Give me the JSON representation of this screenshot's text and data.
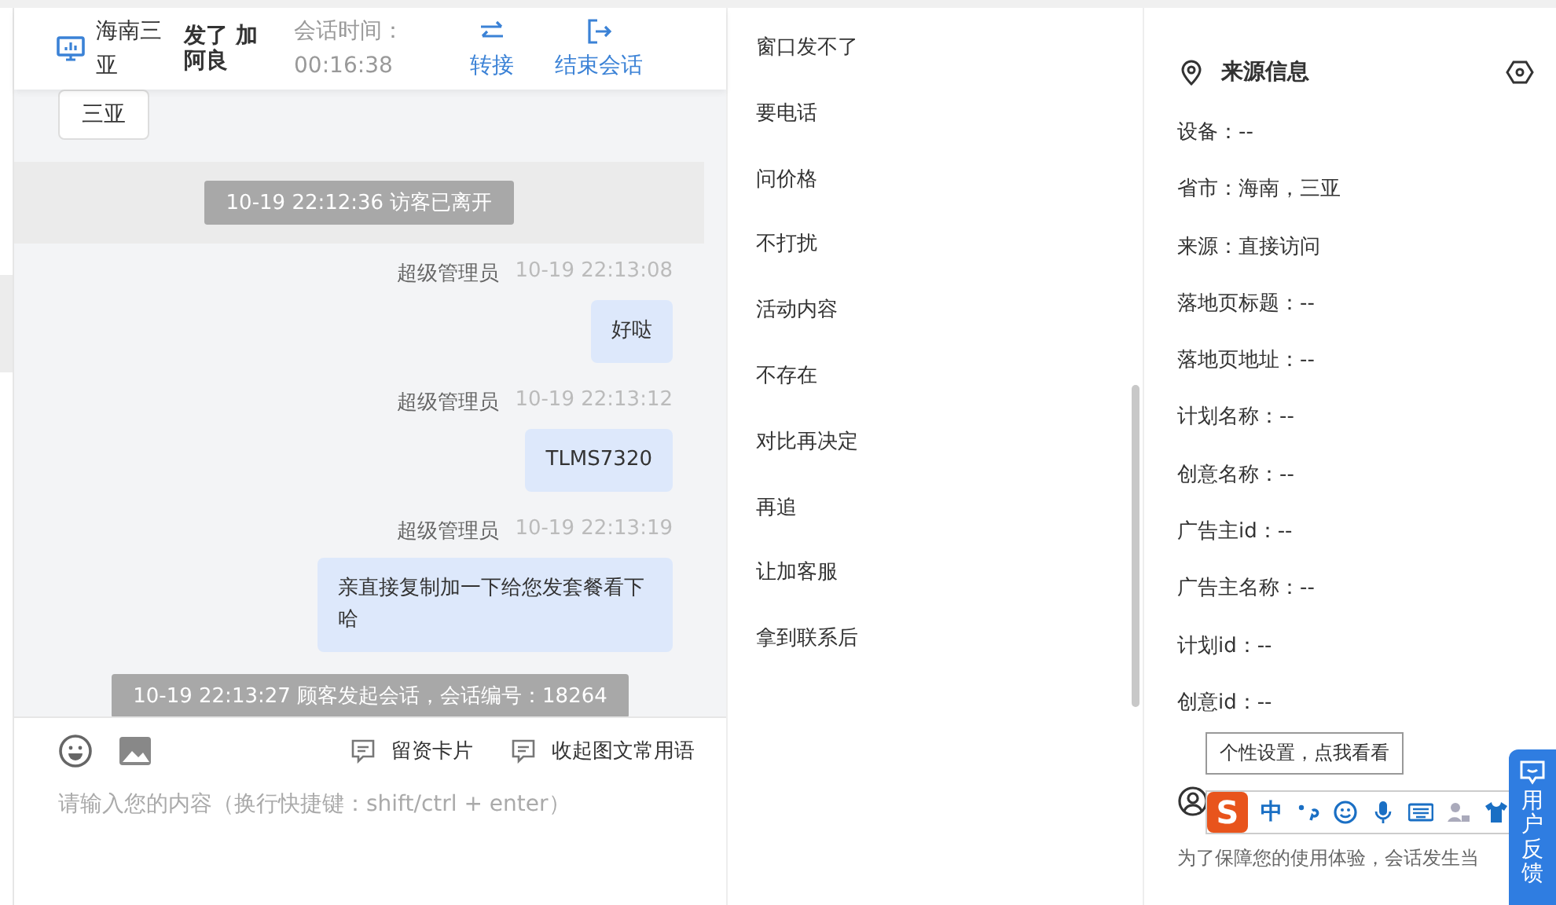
{
  "header": {
    "location": "海南三亚",
    "visitor": "发了 加阿良",
    "timer_label": "会话时间：",
    "timer": "00:16:38",
    "actions": [
      {
        "kind": "transfer",
        "label": "转接"
      },
      {
        "kind": "end",
        "label": "结束会话"
      }
    ]
  },
  "messages": [
    {
      "kind": "visitor",
      "text": "三亚"
    },
    {
      "kind": "system",
      "text": "10-19 22:12:36 访客已离开",
      "highlight": true
    },
    {
      "kind": "agent",
      "sender": "超级管理员",
      "time": "10-19 22:13:08",
      "text": "好哒"
    },
    {
      "kind": "agent",
      "sender": "超级管理员",
      "time": "10-19 22:13:12",
      "text": "TLMS7320"
    },
    {
      "kind": "agent",
      "sender": "超级管理员",
      "time": "10-19 22:13:19",
      "text": "亲直接复制加一下给您发套餐看下哈"
    },
    {
      "kind": "system",
      "text": "10-19 22:13:27 顾客发起会话，会话编号：18264",
      "highlight": false
    }
  ],
  "composer": {
    "tools": [
      "留资卡片",
      "收起图文常用语"
    ],
    "placeholder": "请输入您的内容（换行快捷键：shift/ctrl + enter）"
  },
  "quick_replies": [
    "窗口发不了",
    "要电话",
    "问价格",
    "不打扰",
    "活动内容",
    "不存在",
    "对比再决定",
    "再追",
    "让加客服",
    "拿到联系后"
  ],
  "source_info": {
    "title": "来源信息",
    "fields": [
      "设备：--",
      "省市：海南，三亚",
      "来源：直接访问",
      "落地页标题：--",
      "落地页地址：--",
      "计划名称：--",
      "创意名称：--",
      "广告主id：--",
      "广告主名称：--",
      "计划id：--",
      "创意id：--"
    ],
    "notice": "为了保障您的使用体验，会话发生当"
  },
  "ime_toolbar": {
    "tooltip": "个性设置，点我看看",
    "logo": "S",
    "mode": "中"
  },
  "feedback_tab": {
    "label": "用户反馈"
  }
}
